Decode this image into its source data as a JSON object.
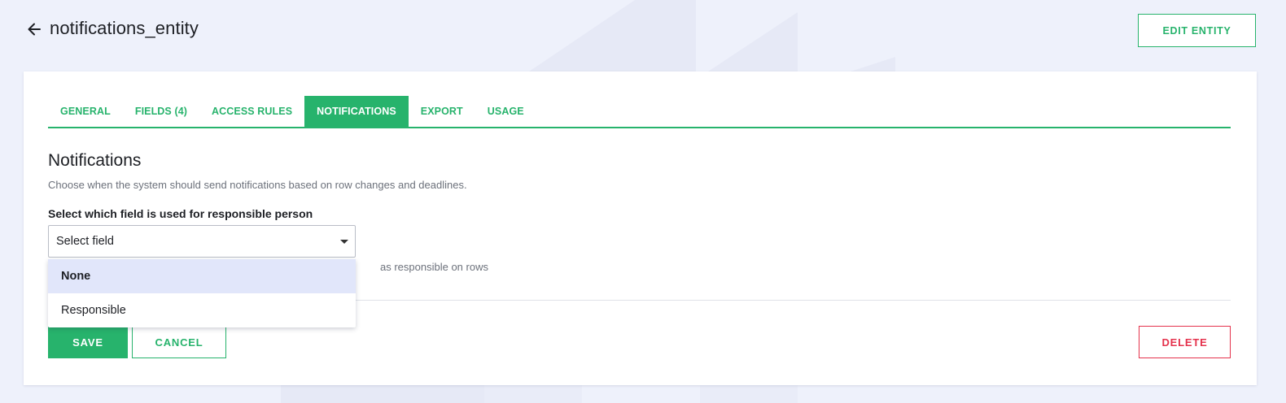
{
  "header": {
    "title": "notifications_entity",
    "back_icon": "arrow-left-icon",
    "edit_entity_label": "EDIT ENTITY"
  },
  "tabs": [
    {
      "label": "GENERAL",
      "active": false
    },
    {
      "label": "FIELDS (4)",
      "active": false
    },
    {
      "label": "ACCESS RULES",
      "active": false
    },
    {
      "label": "NOTIFICATIONS",
      "active": true
    },
    {
      "label": "EXPORT",
      "active": false
    },
    {
      "label": "USAGE",
      "active": false
    }
  ],
  "notifications": {
    "title": "Notifications",
    "description": "Choose when the system should send notifications based on row changes and deadlines.",
    "responsible_field": {
      "label": "Select which field is used for responsible person",
      "value": "Select field",
      "help_text": "as responsible on rows",
      "options": [
        {
          "label": "None",
          "highlighted": true
        },
        {
          "label": "Responsible",
          "highlighted": false
        }
      ]
    }
  },
  "actions": {
    "save_label": "SAVE",
    "cancel_label": "CANCEL",
    "delete_label": "DELETE"
  },
  "colors": {
    "accent": "#27b36c",
    "danger": "#e4324c",
    "background": "#eef1fb",
    "highlight": "#e1e6fa"
  }
}
